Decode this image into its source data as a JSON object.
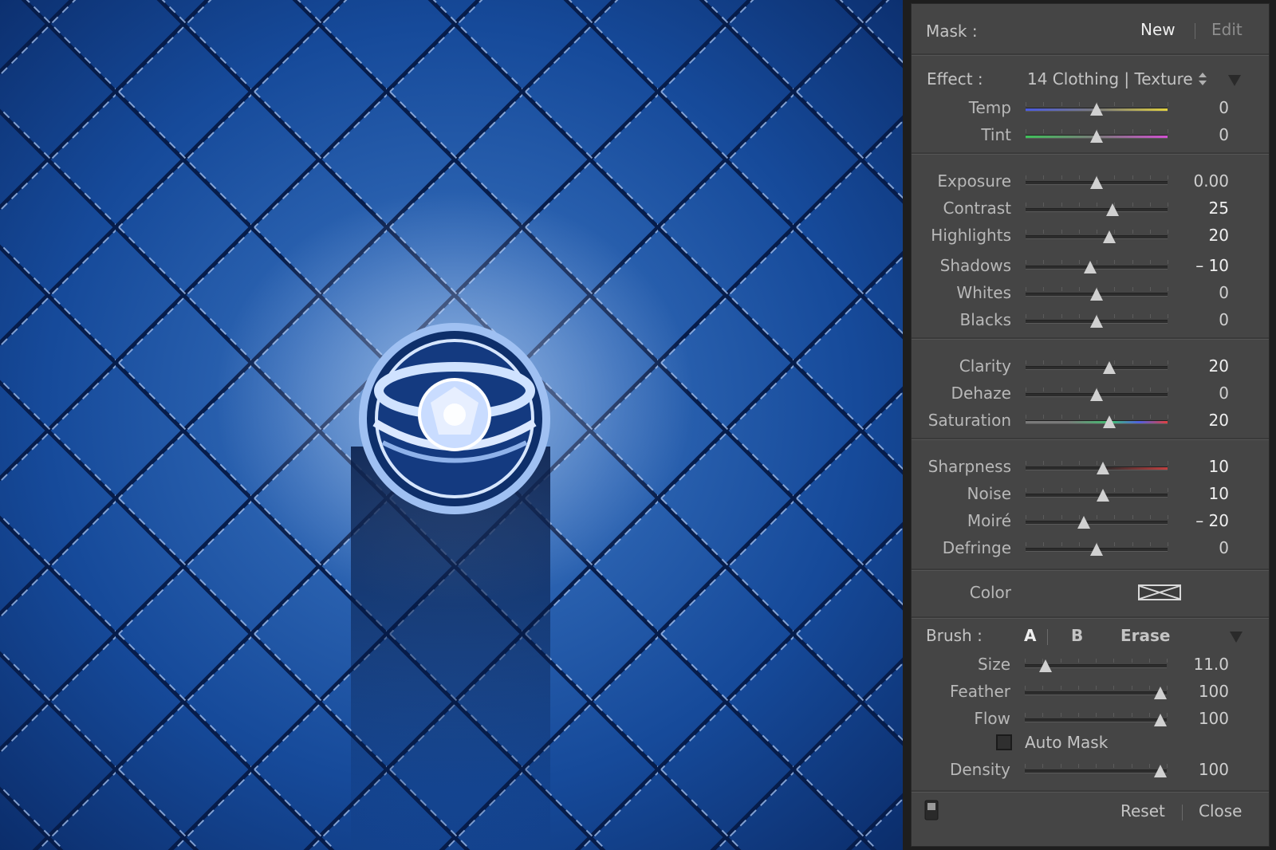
{
  "panel": {
    "mask": {
      "label": "Mask :",
      "new": "New",
      "edit": "Edit"
    },
    "effect": {
      "label": "Effect :",
      "preset": "14 Clothing | Texture"
    },
    "sliders": [
      {
        "label": "Temp",
        "value": "0",
        "pos": 0.5,
        "track": "temp"
      },
      {
        "label": "Tint",
        "value": "0",
        "pos": 0.5,
        "track": "tint"
      },
      {
        "label": "Exposure",
        "value": "0.00",
        "pos": 0.5
      },
      {
        "label": "Contrast",
        "value": "25",
        "pos": 0.625,
        "emph": true
      },
      {
        "label": "Highlights",
        "value": "20",
        "pos": 0.6,
        "emph": true
      },
      {
        "label": "Shadows",
        "value": "– 10",
        "pos": 0.45,
        "emph": true
      },
      {
        "label": "Whites",
        "value": "0",
        "pos": 0.5
      },
      {
        "label": "Blacks",
        "value": "0",
        "pos": 0.5
      },
      {
        "label": "Clarity",
        "value": "20",
        "pos": 0.6,
        "emph": true
      },
      {
        "label": "Dehaze",
        "value": "0",
        "pos": 0.5
      },
      {
        "label": "Saturation",
        "value": "20",
        "pos": 0.6,
        "emph": true,
        "track": "sat"
      },
      {
        "label": "Sharpness",
        "value": "10",
        "pos": 0.55,
        "emph": true,
        "track": "sharp"
      },
      {
        "label": "Noise",
        "value": "10",
        "pos": 0.55,
        "emph": true
      },
      {
        "label": "Moiré",
        "value": "– 20",
        "pos": 0.4,
        "emph": true
      },
      {
        "label": "Defringe",
        "value": "0",
        "pos": 0.5
      }
    ],
    "color": {
      "label": "Color"
    },
    "brush": {
      "label": "Brush :",
      "a": "A",
      "b": "B",
      "erase": "Erase",
      "sliders": [
        {
          "label": "Size",
          "value": "11.0",
          "pos": 0.11
        },
        {
          "label": "Feather",
          "value": "100",
          "pos": 1.0
        },
        {
          "label": "Flow",
          "value": "100",
          "pos": 1.0
        }
      ],
      "auto_mask": "Auto Mask",
      "density": {
        "label": "Density",
        "value": "100",
        "pos": 1.0
      }
    },
    "footer": {
      "reset": "Reset",
      "close": "Close"
    }
  },
  "colors": {
    "panel": "#454545",
    "photo_blue": "#1a4fa0"
  },
  "icons": [
    "updown-arrows-icon",
    "triangle-down-icon",
    "swatch-x-icon",
    "toggle-switch-icon"
  ]
}
